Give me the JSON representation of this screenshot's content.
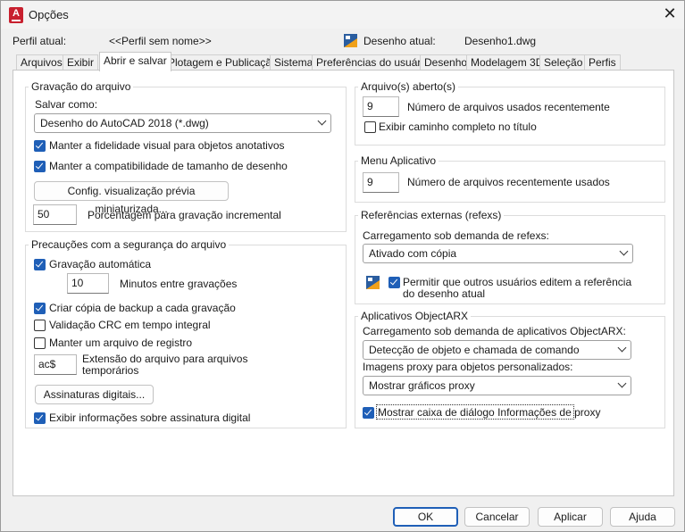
{
  "window": {
    "title": "Opções",
    "close_glyph": "✕",
    "app_icon": "autocad-icon"
  },
  "header": {
    "perfil_label": "Perfil atual:",
    "perfil_value": "<<Perfil sem nome>>",
    "desenho_label": "Desenho atual:",
    "desenho_value": "Desenho1.dwg"
  },
  "tabs": [
    {
      "label": "Arquivos"
    },
    {
      "label": "Exibir"
    },
    {
      "label": "Abrir e salvar",
      "active": true
    },
    {
      "label": "Plotagem e Publicação"
    },
    {
      "label": "Sistema"
    },
    {
      "label": "Preferências do usuário"
    },
    {
      "label": "Desenho"
    },
    {
      "label": "Modelagem 3D"
    },
    {
      "label": "Seleção"
    },
    {
      "label": "Perfis"
    }
  ],
  "gravacao": {
    "title": "Gravação do arquivo",
    "salvar_label": "Salvar como:",
    "salvar_value": "Desenho do AutoCAD 2018 (*.dwg)",
    "fidelidade": {
      "label": "Manter a fidelidade visual para objetos anotativos",
      "checked": true
    },
    "compatibilidade": {
      "label": "Manter a compatibilidade de tamanho de desenho",
      "checked": true
    },
    "config_button": "Config. visualização prévia miniaturizada...",
    "porcentagem_value": "50",
    "porcentagem_label": "Porcentagem para gravação incremental"
  },
  "precaucoes": {
    "title": "Precauções com a segurança do arquivo",
    "gravacao_auto": {
      "label": "Gravação automática",
      "checked": true
    },
    "minutos_value": "10",
    "minutos_label": "Minutos entre gravações",
    "backup": {
      "label": "Criar cópia de backup a cada gravação",
      "checked": true
    },
    "crc": {
      "label": "Validação CRC em tempo integral",
      "checked": false
    },
    "registro": {
      "label": "Manter um arquivo de registro",
      "checked": false
    },
    "extensao_value": "ac$",
    "extensao_label_1": "Extensão do arquivo para arquivos",
    "extensao_label_2": "temporários",
    "assinaturas_button": "Assinaturas digitais...",
    "exibir_assinatura": {
      "label": "Exibir informações sobre assinatura digital",
      "checked": true
    }
  },
  "abertos": {
    "title": "Arquivo(s) aberto(s)",
    "numero_value": "9",
    "numero_label": "Número de arquivos usados recentemente",
    "caminho": {
      "label": "Exibir caminho completo no título",
      "checked": false
    }
  },
  "menu_app": {
    "title": "Menu Aplicativo",
    "numero_value": "9",
    "numero_label": "Número de arquivos recentemente usados"
  },
  "refexs": {
    "title": "Referências externas (refexs)",
    "carregamento_label": "Carregamento sob demanda de refexs:",
    "carregamento_value": "Ativado com cópia",
    "permitir": {
      "label_1": "Permitir que outros usuários editem a referência",
      "label_2": "do desenho atual",
      "checked": true
    }
  },
  "objectarx": {
    "title": "Aplicativos ObjectARX",
    "carregamento_label": "Carregamento sob demanda de aplicativos ObjectARX:",
    "carregamento_value": "Detecção de objeto e chamada de comando",
    "proxy_label": "Imagens proxy para objetos personalizados:",
    "proxy_value": "Mostrar gráficos proxy",
    "mostrar_caixa": {
      "label": "Mostrar caixa de diálogo Informações de proxy",
      "checked": true
    }
  },
  "footer": {
    "ok": "OK",
    "cancelar": "Cancelar",
    "aplicar": "Aplicar",
    "ajuda": "Ajuda"
  },
  "colors": {
    "accent": "#1f5fb7",
    "autocad_red": "#c8202f"
  }
}
